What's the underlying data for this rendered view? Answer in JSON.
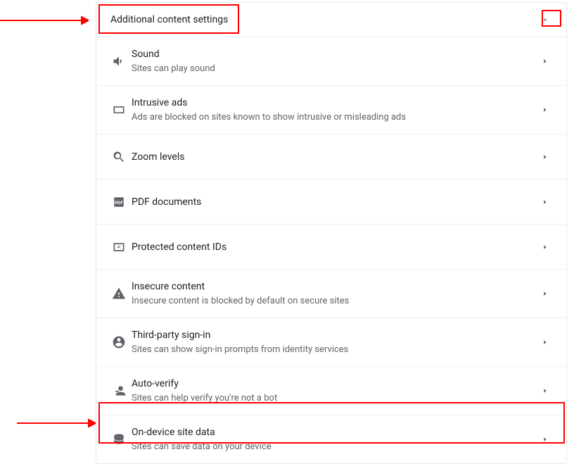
{
  "header": {
    "title": "Additional content settings"
  },
  "items": [
    {
      "icon": "sound-icon",
      "title": "Sound",
      "sub": "Sites can play sound"
    },
    {
      "icon": "tab-icon",
      "title": "Intrusive ads",
      "sub": "Ads are blocked on sites known to show intrusive or misleading ads"
    },
    {
      "icon": "search-icon",
      "title": "Zoom levels",
      "sub": ""
    },
    {
      "icon": "pdf-icon",
      "title": "PDF documents",
      "sub": ""
    },
    {
      "icon": "protected-icon",
      "title": "Protected content IDs",
      "sub": ""
    },
    {
      "icon": "warning-icon",
      "title": "Insecure content",
      "sub": "Insecure content is blocked by default on secure sites"
    },
    {
      "icon": "person-circle-icon",
      "title": "Third-party sign-in",
      "sub": "Sites can show sign-in prompts from identity services"
    },
    {
      "icon": "person-minus-icon",
      "title": "Auto-verify",
      "sub": "Sites can help verify you're not a bot"
    },
    {
      "icon": "database-icon",
      "title": "On-device site data",
      "sub": "Sites can save data on your device"
    }
  ]
}
